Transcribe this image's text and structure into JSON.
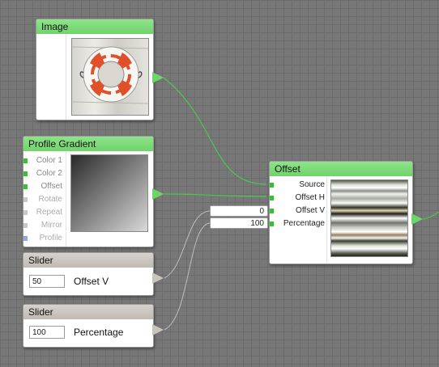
{
  "image_node": {
    "title": "Image"
  },
  "profile_node": {
    "title": "Profile Gradient",
    "inputs": [
      {
        "label": "Color 1",
        "connected": true
      },
      {
        "label": "Color 2",
        "connected": true
      },
      {
        "label": "Offset",
        "connected": true
      },
      {
        "label": "Rotate",
        "connected": false
      },
      {
        "label": "Repeat",
        "connected": false
      },
      {
        "label": "Mirror",
        "connected": false
      },
      {
        "label": "Profile",
        "connected": false
      }
    ]
  },
  "slider_v": {
    "title": "Slider",
    "value": "50",
    "label": "Offset V"
  },
  "slider_p": {
    "title": "Slider",
    "value": "100",
    "label": "Percentage"
  },
  "offset_node": {
    "title": "Offset",
    "inputs": [
      "Source",
      "Offset H",
      "Offset V",
      "Percentage"
    ],
    "offset_v_value": "0",
    "percentage_value": "100"
  },
  "colors": {
    "accent": "#6fd46a",
    "wire_green": "#4cc84c",
    "wire_gray": "#bdbdbd"
  }
}
